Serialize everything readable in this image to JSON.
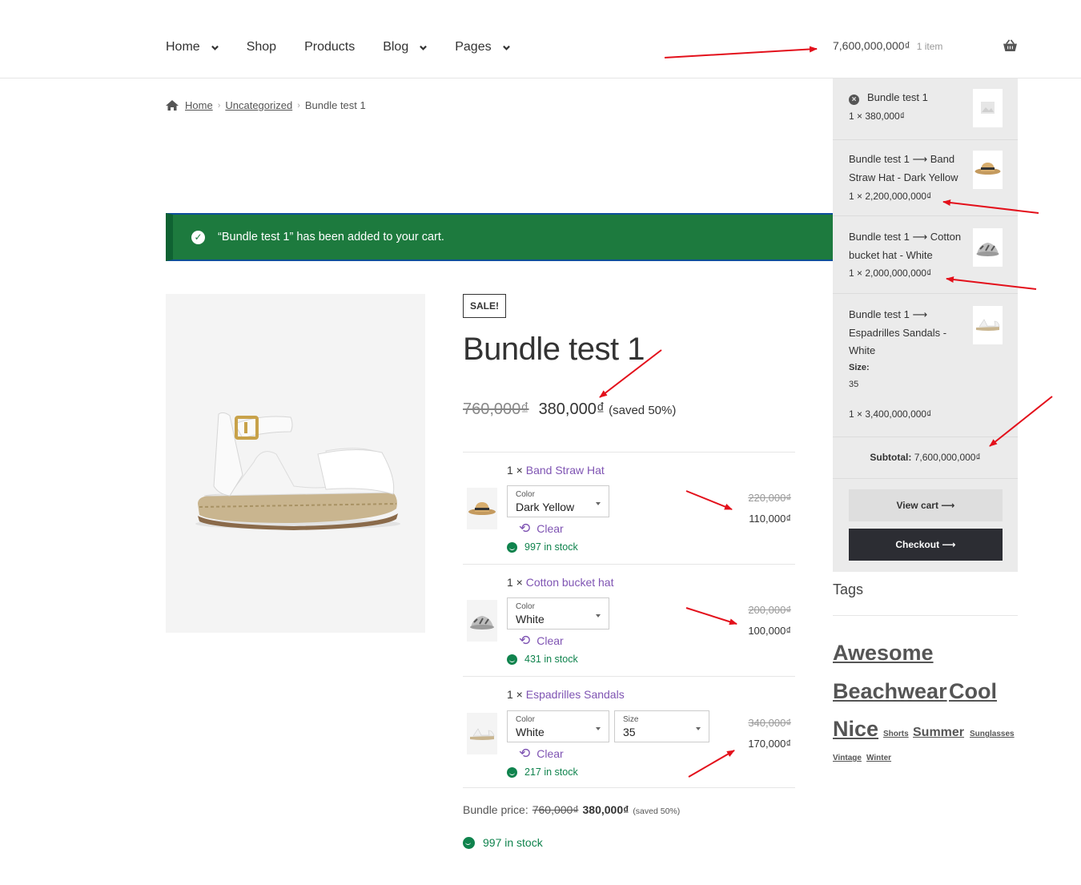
{
  "nav": {
    "items": [
      {
        "label": "Home",
        "dropdown": true
      },
      {
        "label": "Shop",
        "dropdown": false
      },
      {
        "label": "Products",
        "dropdown": false
      },
      {
        "label": "Blog",
        "dropdown": true
      },
      {
        "label": "Pages",
        "dropdown": true
      }
    ]
  },
  "cart_summary": {
    "total": "7,600,000,000₫",
    "count": "1 item"
  },
  "mini_cart": {
    "items": [
      {
        "name": "Bundle test 1",
        "qty_price": "1 × 380,000₫"
      },
      {
        "name_lines": [
          "Bundle test 1 ⟶ Band",
          "Straw Hat - Dark Yellow"
        ],
        "qty_price": "1 × 2,200,000,000₫"
      },
      {
        "name_lines": [
          "Bundle test 1 ⟶ Cotton",
          "bucket hat - White"
        ],
        "qty_price": "1 × 2,000,000,000₫"
      },
      {
        "name_lines": [
          "Bundle test 1 ⟶",
          "Espadrilles Sandals -",
          "White"
        ],
        "meta_label": "Size:",
        "meta_value": "35",
        "qty_price": "1 × 3,400,000,000₫"
      }
    ],
    "subtotal_label": "Subtotal:",
    "subtotal_value": "7,600,000,000₫",
    "view_cart": "View cart  ⟶",
    "checkout": "Checkout  ⟶"
  },
  "breadcrumb": {
    "home": "Home",
    "category": "Uncategorized",
    "current": "Bundle test 1"
  },
  "notice": {
    "text": "“Bundle test 1” has been added to your cart."
  },
  "product": {
    "sale_badge": "SALE!",
    "title": "Bundle test 1",
    "price_old": "760,000₫",
    "price_new": "380,000₫",
    "saved": "(saved 50%)"
  },
  "bundle_items": [
    {
      "qty": "1 ×",
      "name": "Band Straw Hat",
      "selects": [
        {
          "label": "Color",
          "value": "Dark Yellow"
        }
      ],
      "clear": "Clear",
      "stock": "997 in stock",
      "price_old": "220,000₫",
      "price_new": "110,000₫"
    },
    {
      "qty": "1 ×",
      "name": "Cotton bucket hat",
      "selects": [
        {
          "label": "Color",
          "value": "White"
        }
      ],
      "clear": "Clear",
      "stock": "431 in stock",
      "price_old": "200,000₫",
      "price_new": "100,000₫"
    },
    {
      "qty": "1 ×",
      "name": "Espadrilles Sandals",
      "selects": [
        {
          "label": "Color",
          "value": "White"
        },
        {
          "label": "Size",
          "value": "35"
        }
      ],
      "clear": "Clear",
      "stock": "217 in stock",
      "price_old": "340,000₫",
      "price_new": "170,000₫"
    }
  ],
  "bundle_price": {
    "label": "Bundle price:",
    "old": "760,000₫",
    "new": "380,000₫",
    "saved": "(saved 50%)"
  },
  "main_stock": "997 in stock",
  "tags": {
    "title": "Tags",
    "items": [
      "Awesome",
      "Beachwear",
      "Cool",
      "Nice",
      "Shorts",
      "Summer",
      "Sunglasses",
      "Vintage",
      "Winter"
    ]
  },
  "colors": {
    "accent": "#7f54b3",
    "success": "#0f834d",
    "notice_bg": "#1d7a3e",
    "annotation": "#e3101b"
  }
}
